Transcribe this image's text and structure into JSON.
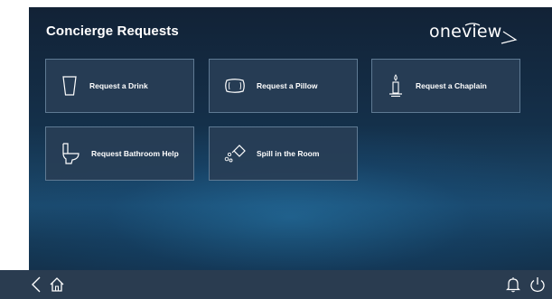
{
  "header": {
    "title": "Concierge Requests",
    "logo_text": "oneview"
  },
  "tiles": [
    {
      "label": "Request a Drink",
      "icon": "drink-cup-icon"
    },
    {
      "label": "Request a Pillow",
      "icon": "pillow-icon"
    },
    {
      "label": "Request a Chaplain",
      "icon": "candle-icon"
    },
    {
      "label": "Request Bathroom Help",
      "icon": "toilet-icon"
    },
    {
      "label": "Spill in the Room",
      "icon": "spill-icon"
    }
  ],
  "bottom_bar": {
    "left_icons": [
      "back-arrow-icon",
      "home-icon"
    ],
    "right_icons": [
      "bell-icon",
      "power-icon"
    ]
  },
  "colors": {
    "background_top": "#122236",
    "background_mid": "#1b4a6e",
    "tile_bg": "#283e56",
    "tile_border": "#5f7a93",
    "text": "#ffffff",
    "bottom_bar": "#2a3c50"
  }
}
